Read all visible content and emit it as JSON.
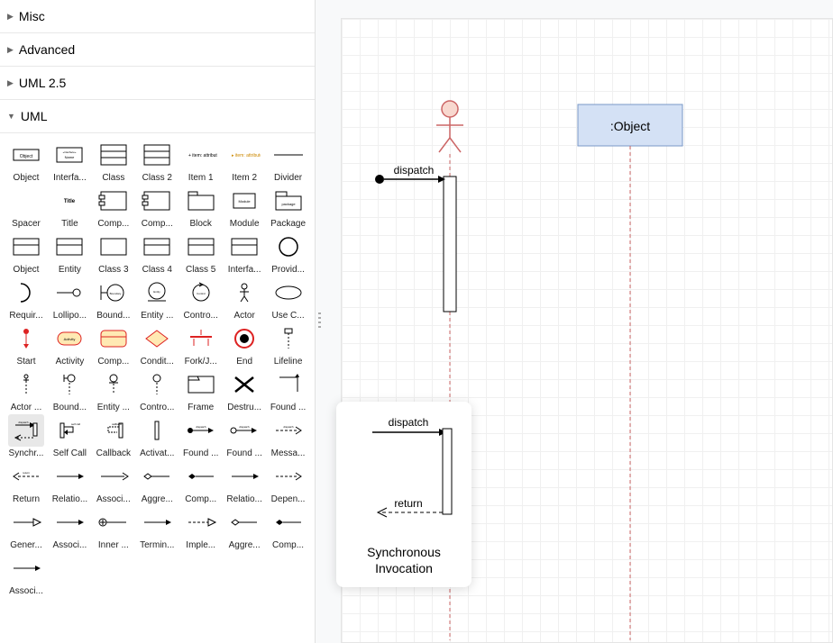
{
  "sidebar": {
    "sections": [
      {
        "label": "Misc",
        "expanded": false
      },
      {
        "label": "Advanced",
        "expanded": false
      },
      {
        "label": "UML 2.5",
        "expanded": false
      },
      {
        "label": "UML",
        "expanded": true
      }
    ],
    "uml_shapes": [
      {
        "label": "Object",
        "icon": "rect-text"
      },
      {
        "label": "Interfa...",
        "icon": "rect-interface"
      },
      {
        "label": "Class",
        "icon": "rect-3band"
      },
      {
        "label": "Class 2",
        "icon": "rect-3band"
      },
      {
        "label": "Item 1",
        "icon": "item-text"
      },
      {
        "label": "Item 2",
        "icon": "item-text-y"
      },
      {
        "label": "Divider",
        "icon": "hline"
      },
      {
        "label": "Spacer",
        "icon": "blank"
      },
      {
        "label": "Title",
        "icon": "title-text"
      },
      {
        "label": "Comp...",
        "icon": "comp1"
      },
      {
        "label": "Comp...",
        "icon": "comp1"
      },
      {
        "label": "Block",
        "icon": "block-tab"
      },
      {
        "label": "Module",
        "icon": "module"
      },
      {
        "label": "Package",
        "icon": "package"
      },
      {
        "label": "Object",
        "icon": "rect-2band"
      },
      {
        "label": "Entity",
        "icon": "rect-2band"
      },
      {
        "label": "Class 3",
        "icon": "rect-2band-o"
      },
      {
        "label": "Class 4",
        "icon": "rect-2band"
      },
      {
        "label": "Class 5",
        "icon": "rect-2band"
      },
      {
        "label": "Interfa...",
        "icon": "rect-2band"
      },
      {
        "label": "Provid...",
        "icon": "circle-o"
      },
      {
        "label": "Requir...",
        "icon": "half-arc"
      },
      {
        "label": "Lollipo...",
        "icon": "lollipop"
      },
      {
        "label": "Bound...",
        "icon": "boundary-obj"
      },
      {
        "label": "Entity ...",
        "icon": "entity-obj"
      },
      {
        "label": "Contro...",
        "icon": "control-obj"
      },
      {
        "label": "Actor",
        "icon": "actor"
      },
      {
        "label": "Use C...",
        "icon": "oval"
      },
      {
        "label": "Start",
        "icon": "red-start"
      },
      {
        "label": "Activity",
        "icon": "red-activity"
      },
      {
        "label": "Comp...",
        "icon": "red-composite"
      },
      {
        "label": "Condit...",
        "icon": "red-diamond"
      },
      {
        "label": "Fork/J...",
        "icon": "red-fork"
      },
      {
        "label": "End",
        "icon": "red-end"
      },
      {
        "label": "Lifeline",
        "icon": "lifeline"
      },
      {
        "label": "Actor ...",
        "icon": "actor-life"
      },
      {
        "label": "Bound...",
        "icon": "bound-life"
      },
      {
        "label": "Entity ...",
        "icon": "entity-life"
      },
      {
        "label": "Contro...",
        "icon": "control-life"
      },
      {
        "label": "Frame",
        "icon": "frame"
      },
      {
        "label": "Destru...",
        "icon": "cross"
      },
      {
        "label": "Found ...",
        "icon": "found-corner"
      },
      {
        "label": "Synchr...",
        "icon": "synch-inv",
        "selected": true
      },
      {
        "label": "Self Call",
        "icon": "self-call"
      },
      {
        "label": "Callback",
        "icon": "callback"
      },
      {
        "label": "Activat...",
        "icon": "activation-bar"
      },
      {
        "label": "Found ...",
        "icon": "found-msg"
      },
      {
        "label": "Found ...",
        "icon": "found-msg-o"
      },
      {
        "label": "Messa...",
        "icon": "arrow-dash"
      },
      {
        "label": "Return",
        "icon": "arrow-return"
      },
      {
        "label": "Relatio...",
        "icon": "arrow-solid"
      },
      {
        "label": "Associ...",
        "icon": "arrow-open"
      },
      {
        "label": "Aggre...",
        "icon": "arrow-diamond"
      },
      {
        "label": "Comp...",
        "icon": "arrow-filled-diamond"
      },
      {
        "label": "Relatio...",
        "icon": "arrow-solid"
      },
      {
        "label": "Depen...",
        "icon": "arrow-dash-open"
      },
      {
        "label": "Gener...",
        "icon": "arrow-tri"
      },
      {
        "label": "Associ...",
        "icon": "arrow-solid"
      },
      {
        "label": "Inner ...",
        "icon": "arrow-circle"
      },
      {
        "label": "Termin...",
        "icon": "arrow-solid"
      },
      {
        "label": "Imple...",
        "icon": "arrow-dash-tri"
      },
      {
        "label": "Aggre...",
        "icon": "arrow-diamond"
      },
      {
        "label": "Comp...",
        "icon": "arrow-filled-diamond"
      },
      {
        "label": "Associ...",
        "icon": "arrow-solid"
      }
    ]
  },
  "canvas": {
    "elements": {
      "object_label": ":Object",
      "dispatch_label": "dispatch"
    }
  },
  "tooltip": {
    "title": "Synchronous Invocation",
    "dispatch": "dispatch",
    "return": "return"
  }
}
